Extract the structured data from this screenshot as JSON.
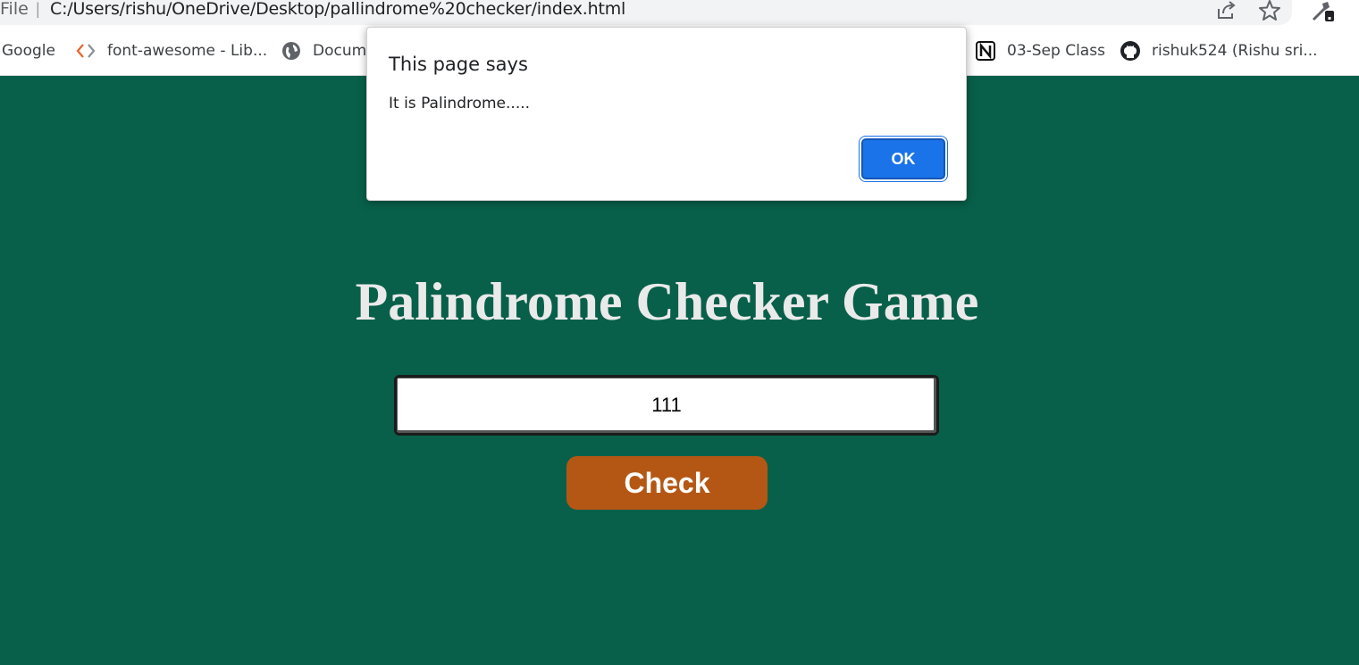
{
  "browser": {
    "url_scheme_label": "File",
    "url": "C:/Users/rishu/OneDrive/Desktop/pallindrome%20checker/index.html",
    "bookmarks": [
      {
        "label": "Google",
        "icon": "google-icon"
      },
      {
        "label": "font-awesome - Lib...",
        "icon": "code-icon"
      },
      {
        "label": "Docume",
        "icon": "globe-icon"
      },
      {
        "label": "03-Sep Class",
        "icon": "notion-icon"
      },
      {
        "label": "rishuk524 (Rishu sri...",
        "icon": "github-icon"
      }
    ]
  },
  "page": {
    "title": "Palindrome Checker Game",
    "input_value": "111",
    "check_label": "Check"
  },
  "dialog": {
    "title": "This page says",
    "message": "It is Palindrome.....",
    "ok_label": "OK"
  },
  "colors": {
    "page_background": "#08604a",
    "check_button": "#b55714",
    "ok_button": "#1a73e8"
  }
}
